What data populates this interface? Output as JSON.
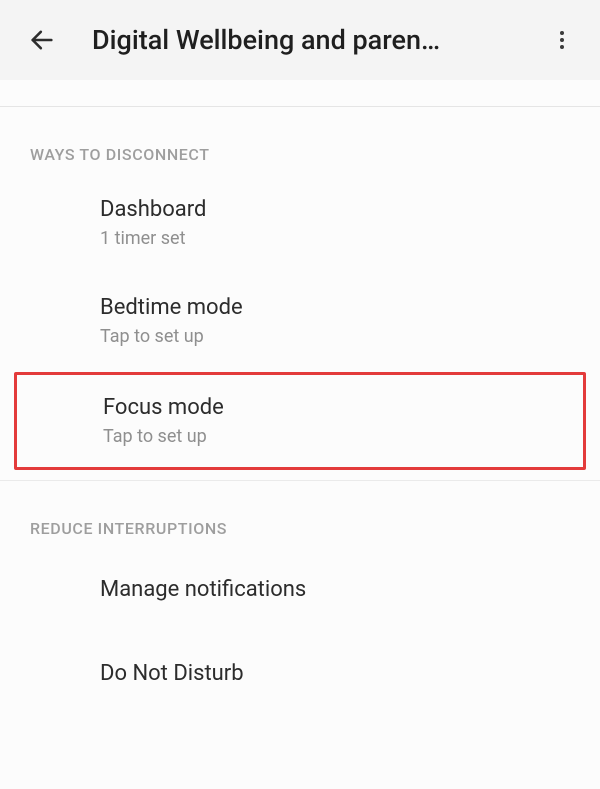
{
  "header": {
    "title": "Digital Wellbeing and paren…"
  },
  "sections": {
    "disconnect": {
      "label": "WAYS TO DISCONNECT",
      "dashboard": {
        "title": "Dashboard",
        "subtitle": "1 timer set"
      },
      "bedtime": {
        "title": "Bedtime mode",
        "subtitle": "Tap to set up"
      },
      "focus": {
        "title": "Focus mode",
        "subtitle": "Tap to set up"
      }
    },
    "reduce": {
      "label": "REDUCE INTERRUPTIONS",
      "notifications": {
        "title": "Manage notifications"
      },
      "dnd": {
        "title": "Do Not Disturb"
      }
    }
  }
}
